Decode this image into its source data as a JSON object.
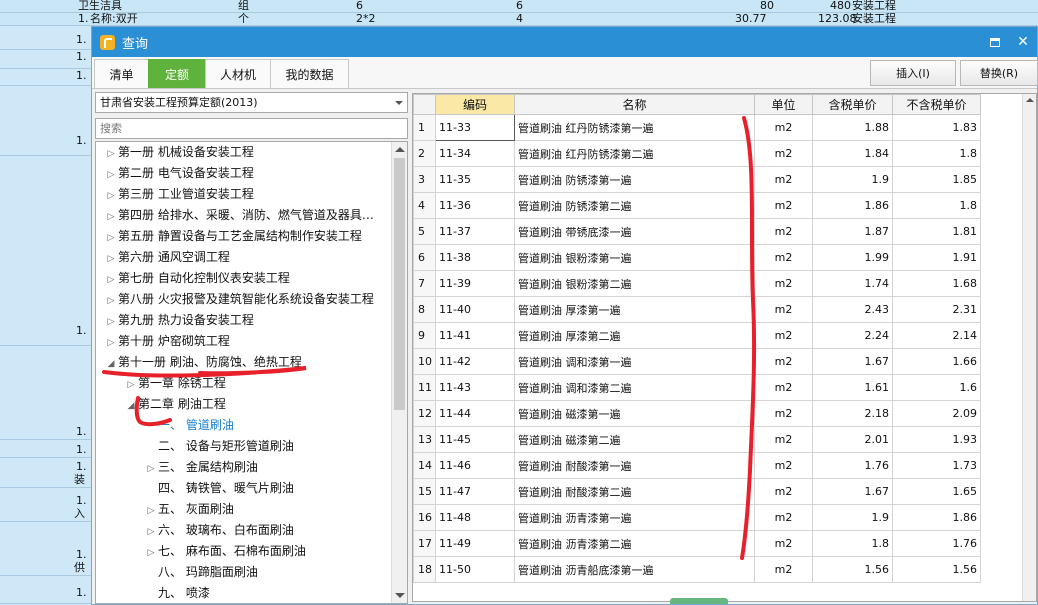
{
  "background": {
    "header_row1": [
      "卫生洁具",
      "组",
      "6",
      "6",
      "80",
      "480",
      "安装工程"
    ],
    "header_row2": [
      "1.",
      "名称:双开",
      "个",
      "2*2",
      "4",
      "30.77",
      "123.08",
      "安装工程"
    ],
    "left_rows": [
      "1.",
      "1.",
      "1.",
      "1.",
      "1.",
      "1.",
      "1.",
      "1.",
      "1.",
      "1.",
      "1."
    ],
    "left_extra": [
      "装",
      "入",
      "供"
    ]
  },
  "window": {
    "title": "查询",
    "maximize_label": "maximize",
    "close_label": "✕"
  },
  "tabs": [
    {
      "label": "清单",
      "active": false
    },
    {
      "label": "定额",
      "active": true
    },
    {
      "label": "人材机",
      "active": false
    },
    {
      "label": "我的数据",
      "active": false
    }
  ],
  "actions": {
    "insert_label": "插入(I)",
    "replace_label": "替换(R)"
  },
  "left": {
    "quota_select": "甘肃省安装工程预算定额(2013)",
    "search_placeholder": "搜索",
    "tree": [
      {
        "label": "第一册 机械设备安装工程",
        "level": 0,
        "state": "collapsed"
      },
      {
        "label": "第二册 电气设备安装工程",
        "level": 0,
        "state": "collapsed"
      },
      {
        "label": "第三册 工业管道安装工程",
        "level": 0,
        "state": "collapsed"
      },
      {
        "label": "第四册 给排水、采暖、消防、燃气管道及器具…",
        "level": 0,
        "state": "collapsed"
      },
      {
        "label": "第五册 静置设备与工艺金属结构制作安装工程",
        "level": 0,
        "state": "collapsed"
      },
      {
        "label": "第六册 通风空调工程",
        "level": 0,
        "state": "collapsed"
      },
      {
        "label": "第七册 自动化控制仪表安装工程",
        "level": 0,
        "state": "collapsed"
      },
      {
        "label": "第八册 火灾报警及建筑智能化系统设备安装工程",
        "level": 0,
        "state": "collapsed"
      },
      {
        "label": "第九册 热力设备安装工程",
        "level": 0,
        "state": "collapsed"
      },
      {
        "label": "第十册 炉窑砌筑工程",
        "level": 0,
        "state": "collapsed"
      },
      {
        "label": "第十一册 刷油、防腐蚀、绝热工程",
        "level": 0,
        "state": "expanded"
      },
      {
        "label": "第一章 除锈工程",
        "level": 1,
        "state": "collapsed"
      },
      {
        "label": "第二章 刷油工程",
        "level": 1,
        "state": "expanded"
      },
      {
        "label": "一、 管道刷油",
        "level": 2,
        "state": "leaf",
        "selected": true
      },
      {
        "label": "二、 设备与矩形管道刷油",
        "level": 2,
        "state": "leaf"
      },
      {
        "label": "三、 金属结构刷油",
        "level": 2,
        "state": "collapsed"
      },
      {
        "label": "四、 铸铁管、暖气片刷油",
        "level": 2,
        "state": "leaf"
      },
      {
        "label": "五、 灰面刷油",
        "level": 2,
        "state": "collapsed"
      },
      {
        "label": "六、 玻璃布、白布面刷油",
        "level": 2,
        "state": "collapsed"
      },
      {
        "label": "七、 麻布面、石棉布面刷油",
        "level": 2,
        "state": "collapsed"
      },
      {
        "label": "八、 玛蹄脂面刷油",
        "level": 2,
        "state": "leaf"
      },
      {
        "label": "九、 喷漆",
        "level": 2,
        "state": "leaf"
      }
    ]
  },
  "grid": {
    "columns": [
      "",
      "编码",
      "名称",
      "单位",
      "含税单价",
      "不含税单价"
    ],
    "rows": [
      [
        "1",
        "11-33",
        "管道刷油 红丹防锈漆第一遍",
        "m2",
        "1.88",
        "1.83"
      ],
      [
        "2",
        "11-34",
        "管道刷油 红丹防锈漆第二遍",
        "m2",
        "1.84",
        "1.8"
      ],
      [
        "3",
        "11-35",
        "管道刷油 防锈漆第一遍",
        "m2",
        "1.9",
        "1.85"
      ],
      [
        "4",
        "11-36",
        "管道刷油 防锈漆第二遍",
        "m2",
        "1.86",
        "1.8"
      ],
      [
        "5",
        "11-37",
        "管道刷油 带锈底漆一遍",
        "m2",
        "1.87",
        "1.81"
      ],
      [
        "6",
        "11-38",
        "管道刷油 银粉漆第一遍",
        "m2",
        "1.99",
        "1.91"
      ],
      [
        "7",
        "11-39",
        "管道刷油 银粉漆第二遍",
        "m2",
        "1.74",
        "1.68"
      ],
      [
        "8",
        "11-40",
        "管道刷油 厚漆第一遍",
        "m2",
        "2.43",
        "2.31"
      ],
      [
        "9",
        "11-41",
        "管道刷油 厚漆第二遍",
        "m2",
        "2.24",
        "2.14"
      ],
      [
        "10",
        "11-42",
        "管道刷油 调和漆第一遍",
        "m2",
        "1.67",
        "1.66"
      ],
      [
        "11",
        "11-43",
        "管道刷油 调和漆第二遍",
        "m2",
        "1.61",
        "1.6"
      ],
      [
        "12",
        "11-44",
        "管道刷油 磁漆第一遍",
        "m2",
        "2.18",
        "2.09"
      ],
      [
        "13",
        "11-45",
        "管道刷油 磁漆第二遍",
        "m2",
        "2.01",
        "1.93"
      ],
      [
        "14",
        "11-46",
        "管道刷油 耐酸漆第一遍",
        "m2",
        "1.76",
        "1.73"
      ],
      [
        "15",
        "11-47",
        "管道刷油 耐酸漆第二遍",
        "m2",
        "1.67",
        "1.65"
      ],
      [
        "16",
        "11-48",
        "管道刷油 沥青漆第一遍",
        "m2",
        "1.9",
        "1.86"
      ],
      [
        "17",
        "11-49",
        "管道刷油 沥青漆第二遍",
        "m2",
        "1.8",
        "1.76"
      ],
      [
        "18",
        "11-50",
        "管道刷油 沥青船底漆第一遍",
        "m2",
        "1.56",
        "1.56"
      ]
    ],
    "selected_row": 1
  },
  "colors": {
    "title_bar": "#2b8fd6",
    "active_tab": "#5fb33d",
    "annotation": "#e8202a",
    "selected_tree": "#1a7fd1"
  }
}
